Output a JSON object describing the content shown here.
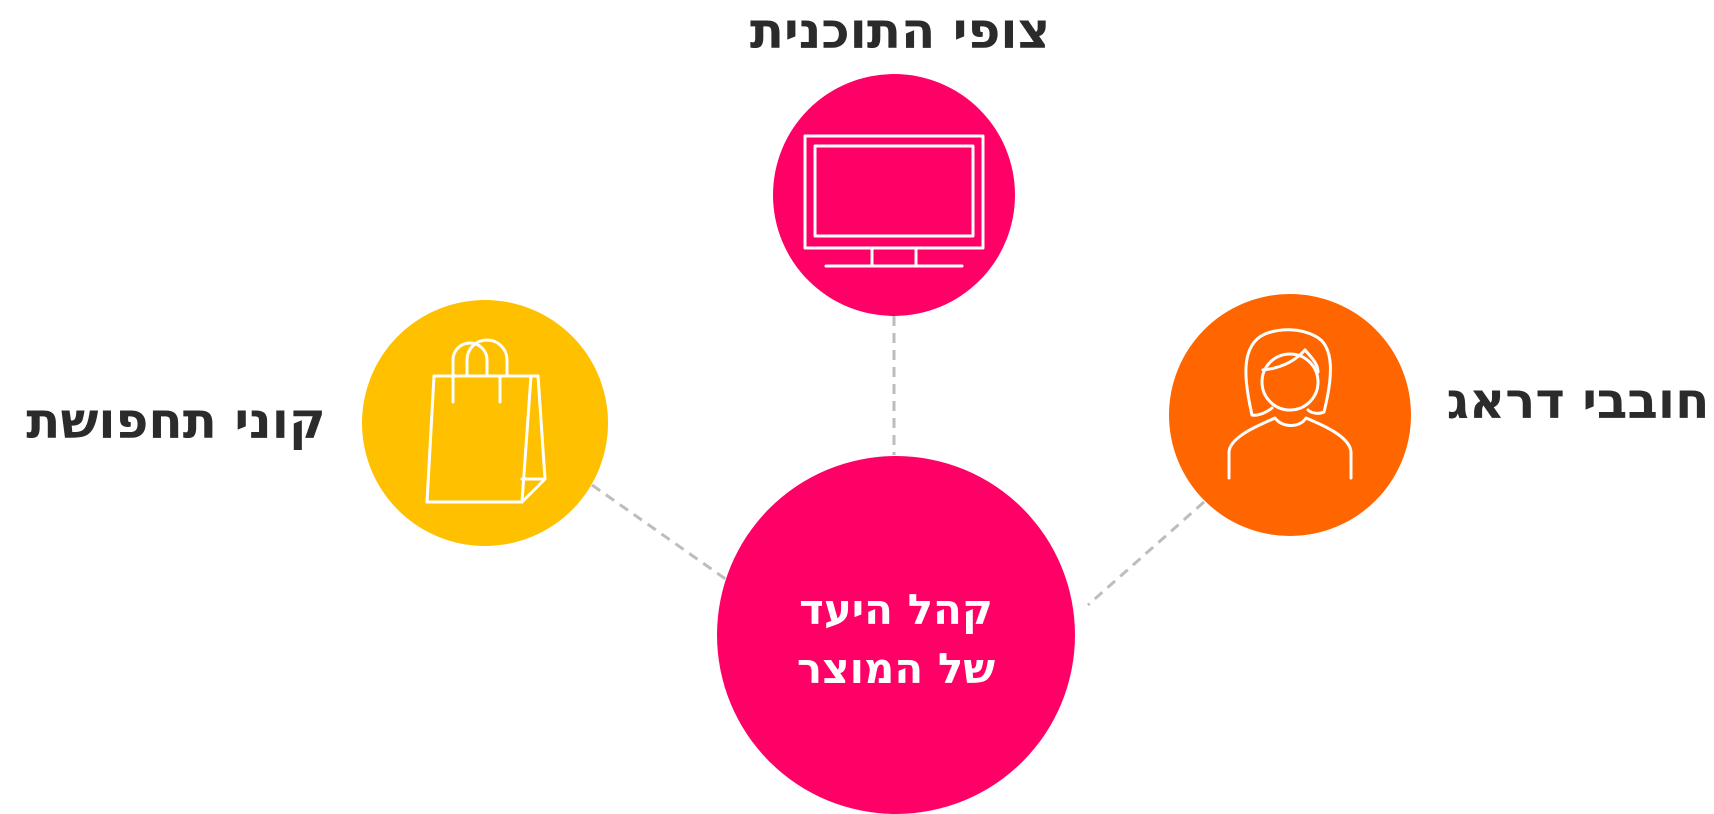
{
  "diagram": {
    "center": {
      "line1": "קהל היעד",
      "line2": "של המוצר",
      "color": "#FF0066"
    },
    "nodes": [
      {
        "id": "tv",
        "label": "צופי התוכנית",
        "icon": "tv-icon",
        "color": "#FF0066"
      },
      {
        "id": "shopping",
        "label": "קוני תחפושת",
        "icon": "shopping-bag-icon",
        "color": "#FFC000"
      },
      {
        "id": "drag",
        "label": "חובבי דראג",
        "icon": "person-icon",
        "color": "#FF6600"
      }
    ],
    "connector_color": "#BDBDBD"
  }
}
